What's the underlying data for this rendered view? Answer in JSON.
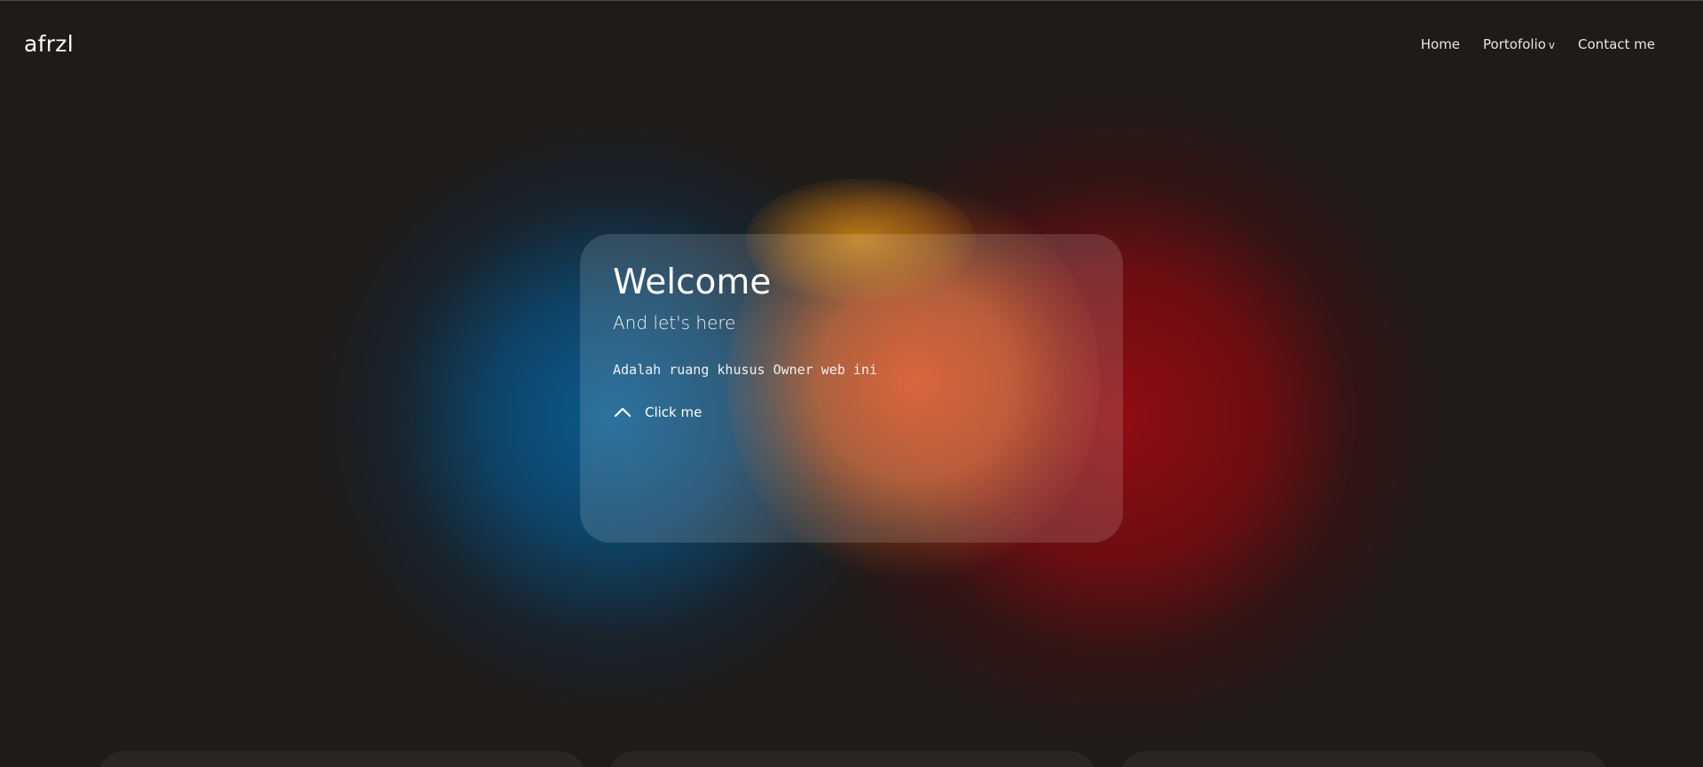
{
  "header": {
    "brand": "afrzl",
    "nav": [
      {
        "label": "Home"
      },
      {
        "label": "Portofolio",
        "caret": "v"
      },
      {
        "label": "Contact me"
      }
    ]
  },
  "hero": {
    "title": "Welcome",
    "subtitle": "And let's here",
    "description": "Adalah ruang khusus Owner web ini",
    "action_label": "Click me",
    "action_icon": "chevron-up-icon"
  },
  "colors": {
    "background": "#1f1b19",
    "blob_blue": "#086096",
    "blob_red": "#960c12",
    "blob_orange": "#dc501e",
    "blob_yellow": "#c88214"
  }
}
